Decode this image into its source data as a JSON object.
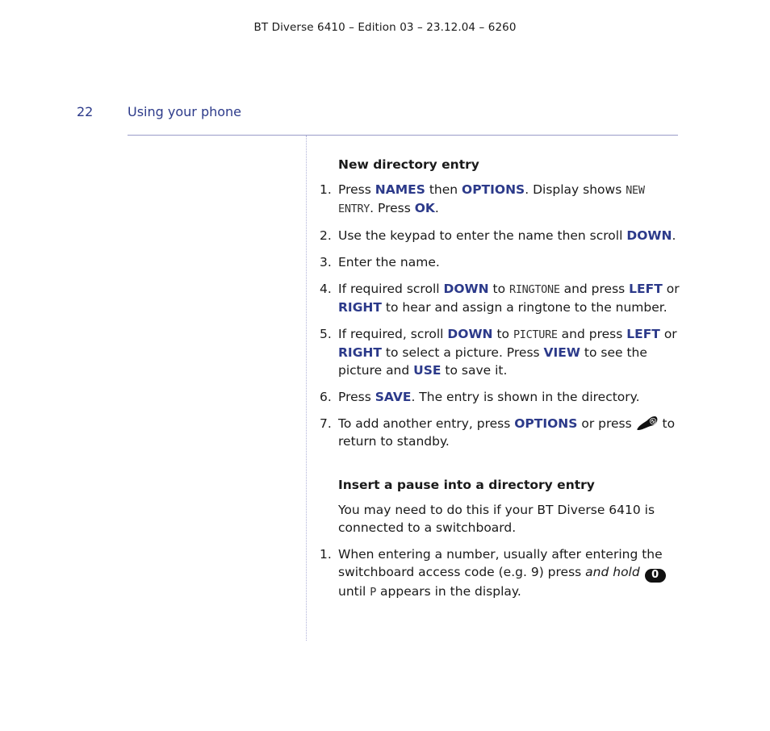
{
  "header": {
    "doc_info": "BT Diverse 6410 – Edition 03 – 23.12.04 – 6260",
    "page_number": "22",
    "section_title": "Using your phone"
  },
  "colors": {
    "accent": "#2c3a8a",
    "rule": "#9a9cc8"
  },
  "new_entry": {
    "heading": "New directory entry",
    "steps": [
      {
        "num": "1.",
        "parts": [
          {
            "t": "Press "
          },
          {
            "k": "NAMES"
          },
          {
            "t": " then "
          },
          {
            "k": "OPTIONS"
          },
          {
            "t": ". Display shows "
          },
          {
            "lcd": "NEW ENTRY"
          },
          {
            "t": ". Press "
          },
          {
            "k": "OK"
          },
          {
            "t": "."
          }
        ]
      },
      {
        "num": "2.",
        "parts": [
          {
            "t": "Use the keypad to enter the name then scroll "
          },
          {
            "k": "DOWN"
          },
          {
            "t": "."
          }
        ]
      },
      {
        "num": "3.",
        "parts": [
          {
            "t": "Enter the name."
          }
        ]
      },
      {
        "num": "4.",
        "parts": [
          {
            "t": "If required scroll "
          },
          {
            "k": "DOWN"
          },
          {
            "t": " to "
          },
          {
            "lcd": "RINGTONE"
          },
          {
            "t": " and press "
          },
          {
            "k": "LEFT"
          },
          {
            "t": " or "
          },
          {
            "k": "RIGHT"
          },
          {
            "t": " to hear and assign a ringtone to the number."
          }
        ]
      },
      {
        "num": "5.",
        "parts": [
          {
            "t": "If required, scroll "
          },
          {
            "k": "DOWN"
          },
          {
            "t": " to "
          },
          {
            "lcd": "PICTURE"
          },
          {
            "t": " and press "
          },
          {
            "k": "LEFT"
          },
          {
            "t": " or "
          },
          {
            "k": "RIGHT"
          },
          {
            "t": " to select a picture. Press "
          },
          {
            "k": "VIEW"
          },
          {
            "t": " to see the picture and "
          },
          {
            "k": "USE"
          },
          {
            "t": " to save it."
          }
        ]
      },
      {
        "num": "6.",
        "parts": [
          {
            "t": "Press "
          },
          {
            "k": "SAVE"
          },
          {
            "t": ". The entry is shown in the directory."
          }
        ]
      },
      {
        "num": "7.",
        "parts": [
          {
            "t": "To add another entry, press "
          },
          {
            "k": "OPTIONS"
          },
          {
            "t": " or press "
          },
          {
            "icon": "end-call-handset-icon"
          },
          {
            "t": " to return to standby."
          }
        ]
      }
    ]
  },
  "pause_entry": {
    "heading": "Insert a pause into a directory entry",
    "intro": "You may need to do this if your BT Diverse 6410 is connected to a switchboard.",
    "steps": [
      {
        "num": "1.",
        "parts": [
          {
            "t": "When entering a number, usually after entering the switchboard access code (e.g. 9) press "
          },
          {
            "i": "and hold"
          },
          {
            "t": " "
          },
          {
            "key": "0"
          },
          {
            "t": " until "
          },
          {
            "lcd": "P"
          },
          {
            "t": " appears in the display."
          }
        ]
      }
    ]
  }
}
